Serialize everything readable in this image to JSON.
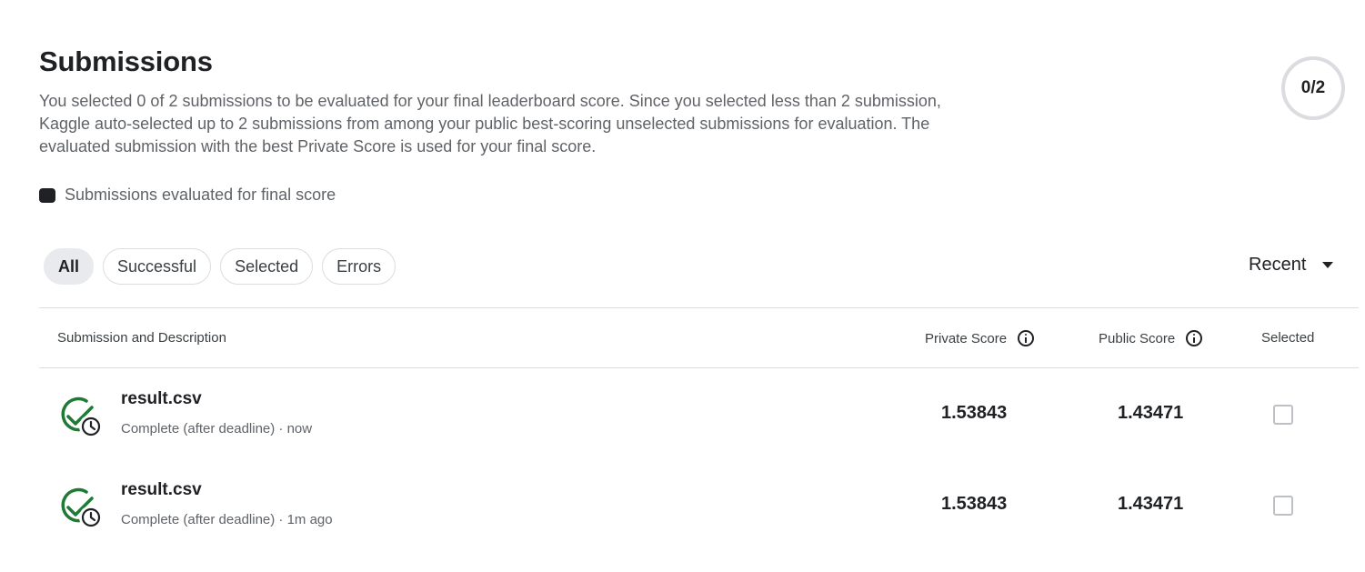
{
  "header": {
    "title": "Submissions",
    "description": "You selected 0 of 2 submissions to be evaluated for your final leaderboard score. Since you selected less than 2 submission, Kaggle auto-selected up to 2 submissions from among your public best-scoring unselected submissions for evaluation. The evaluated submission with the best Private Score is used for your final score.",
    "counter": "0/2"
  },
  "legend": {
    "label": "Submissions evaluated for final score"
  },
  "filters": [
    {
      "label": "All",
      "active": true
    },
    {
      "label": "Successful",
      "active": false
    },
    {
      "label": "Selected",
      "active": false
    },
    {
      "label": "Errors",
      "active": false
    }
  ],
  "sort": {
    "label": "Recent",
    "icon": "chevron-down-icon"
  },
  "table": {
    "columns": {
      "submission": "Submission and Description",
      "private_score": "Private Score",
      "public_score": "Public Score",
      "selected": "Selected"
    },
    "rows": [
      {
        "name": "result.csv",
        "meta": "Complete (after deadline) · now",
        "private_score": "1.53843",
        "public_score": "1.43471",
        "selected": false,
        "icon": "check-clock-icon"
      },
      {
        "name": "result.csv",
        "meta": "Complete (after deadline) · 1m ago",
        "private_score": "1.53843",
        "public_score": "1.43471",
        "selected": false,
        "icon": "check-clock-icon"
      }
    ]
  },
  "colors": {
    "success": "#1e7a34",
    "text": "#202124",
    "muted": "#5f6368",
    "border": "#dadce0"
  }
}
